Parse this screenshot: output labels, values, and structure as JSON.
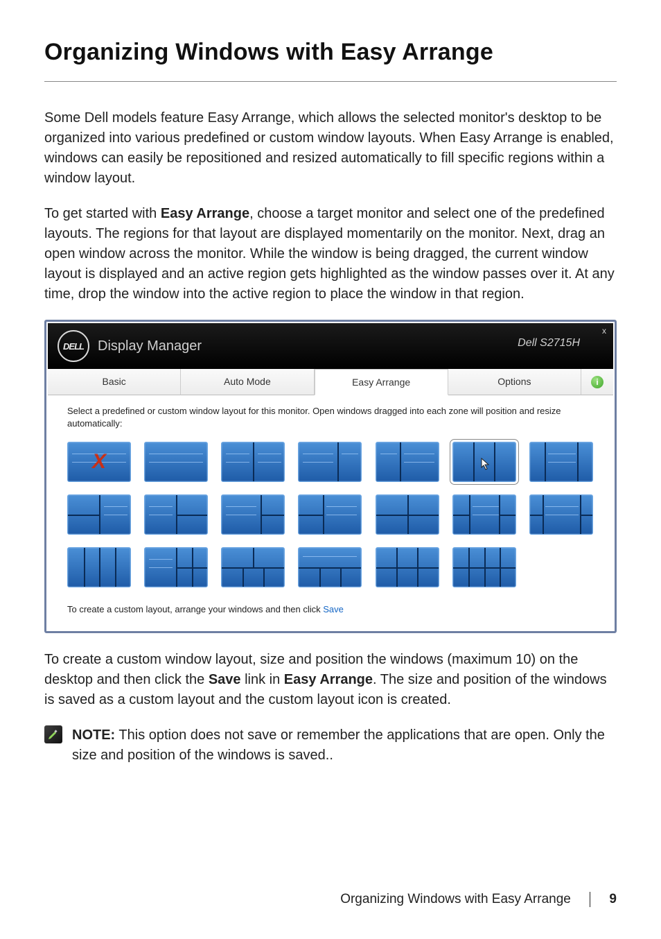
{
  "page": {
    "heading": "Organizing Windows with Easy Arrange",
    "para1": "Some Dell models feature Easy Arrange, which allows the selected monitor's desktop to be organized into various predefined or custom window layouts. When Easy Arrange is enabled, windows can easily be repositioned and resized automatically to fill specific regions within a window layout.",
    "para2_pre": "To get started with ",
    "para2_bold": "Easy Arrange",
    "para2_post": ", choose a target monitor and select one of the predefined layouts. The regions for that layout are displayed momentarily on the monitor. Next, drag an open window across the monitor. While the window is being dragged, the current window layout is displayed and an active region gets highlighted as the window passes over it. At any time, drop the window into the active region to place the window in that region.",
    "para3_pre": "To create a custom window layout, size and position the windows (maximum 10) on the desktop and then click the ",
    "para3_b1": "Save",
    "para3_mid": " link in ",
    "para3_b2": "Easy Arrange",
    "para3_post": ". The size and position of the windows is saved as a custom layout and the custom layout icon is created.",
    "note_label": "NOTE:",
    "note_text": " This option does not save or remember the applications that are open. Only the size and position of the windows is saved..",
    "footer_title": "Organizing Windows with Easy Arrange",
    "footer_page": "9"
  },
  "window": {
    "logo_text": "DELL",
    "app_title": "Display Manager",
    "monitor_model": "Dell S2715H",
    "close": "x",
    "tabs": {
      "basic": "Basic",
      "auto": "Auto Mode",
      "easy": "Easy Arrange",
      "options": "Options"
    },
    "instruction": "Select a predefined or custom window layout for this monitor. Open windows dragged into each zone will position and resize automatically:",
    "save_line_pre": "To create a custom layout, arrange your windows and then click ",
    "save_link": "Save",
    "info_glyph": "i"
  }
}
